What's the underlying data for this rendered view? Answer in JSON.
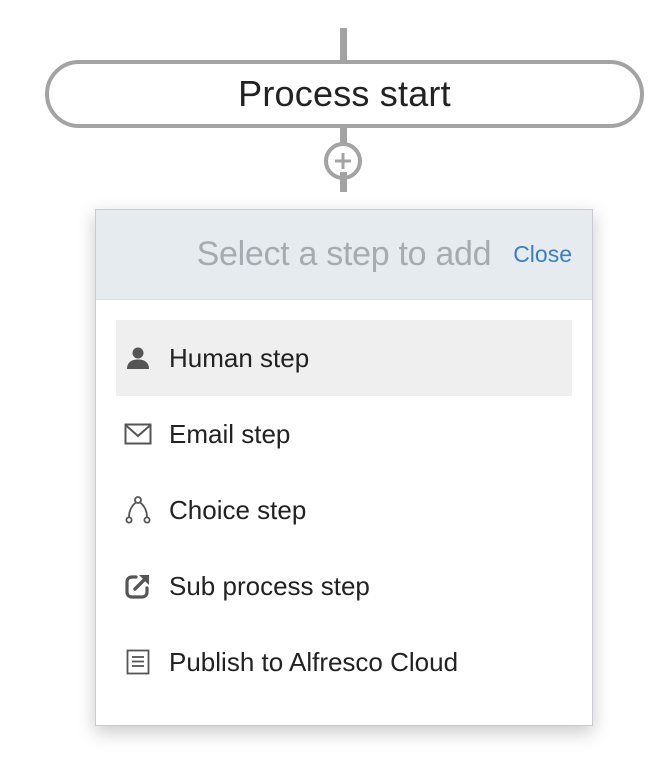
{
  "process": {
    "start_label": "Process start"
  },
  "popover": {
    "title": "Select a step to add",
    "close_label": "Close"
  },
  "steps": [
    {
      "label": "Human step",
      "icon": "person-icon",
      "highlighted": true
    },
    {
      "label": "Email step",
      "icon": "envelope-icon",
      "highlighted": false
    },
    {
      "label": "Choice step",
      "icon": "branch-icon",
      "highlighted": false
    },
    {
      "label": "Sub process step",
      "icon": "external-link-icon",
      "highlighted": false
    },
    {
      "label": "Publish to Alfresco Cloud",
      "icon": "document-icon",
      "highlighted": false
    }
  ],
  "colors": {
    "connector": "#a3a3a3",
    "header_bg": "#e6ebf0",
    "title_text": "#a6abb2",
    "link": "#3a7fc2",
    "highlight_bg": "#efefef",
    "icon": "#555555"
  }
}
